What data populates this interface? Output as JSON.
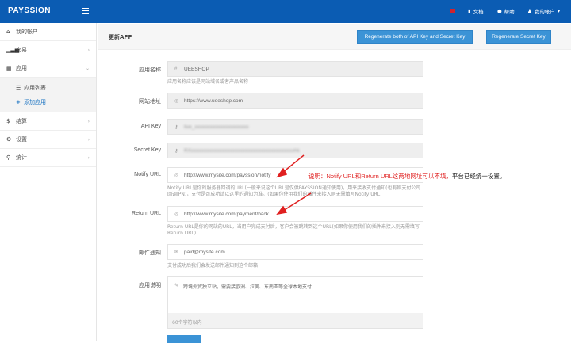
{
  "header": {
    "logo": "PAYSSION",
    "docs": "文档",
    "help": "帮助",
    "account": "我的帐户"
  },
  "sidebar": {
    "items": [
      {
        "label": "我的帐户"
      },
      {
        "label": "交易"
      },
      {
        "label": "应用"
      },
      {
        "label": "结算"
      },
      {
        "label": "设置"
      },
      {
        "label": "统计"
      }
    ],
    "sub": [
      {
        "label": "应用列表"
      },
      {
        "label": "添加应用"
      }
    ]
  },
  "page": {
    "title": "更新APP",
    "btn_both": "Regenerate both of API Key and Secret Key",
    "btn_secret": "Regenerate Secret Key"
  },
  "form": {
    "app_name": {
      "label": "应用名称",
      "value": "UEESHOP",
      "hint": "应用名称应该是网站域名或者产品名称"
    },
    "website": {
      "label": "网站地址",
      "value": "https://www.ueeshop.com"
    },
    "api_key": {
      "label": "API Key",
      "value": "live_xxxxxxxxxxxxxxxxxxxxx"
    },
    "secret_key": {
      "label": "Secret Key",
      "value": "RXxxxxxxxxxxxxxxxxxxxxxxxxxxxxxxxxxxxxxxxxhk"
    },
    "notify": {
      "label": "Notify URL",
      "value": "http://www.mysite.com/payssion/notify",
      "hint": "Notify URL是你的服务器回调的URL(一般来说这个URL是仅供PAYSSION通知使用)，用来接收支付通知(也有称支付公司回调IPN)，支付是否成功请以这里的通知为准。(如果你使用我们的插件来接入则无需填写Notify URL)"
    },
    "return": {
      "label": "Return URL",
      "value": "http://www.mysite.com/payment/back",
      "hint": "Return URL是你的网站的URL，当用户完成支付后，客户会被跳转到这个URL(如果你使用我们的插件来接入则无需填写Return URL)"
    },
    "email": {
      "label": "邮件通知",
      "value": "paid@mysite.com",
      "hint": "支付成功后我们会发送邮件通知到这个邮箱"
    },
    "desc": {
      "label": "应用说明",
      "value": "跨境外贸独立站，需要接欧洲、拉美、东南亚等全球本地支付",
      "counter": "60个字符以内"
    }
  },
  "annotation": {
    "red": "说明：Notify URL和Return URL这两地网址可以不填，",
    "black": "平台已经统一设置。"
  }
}
